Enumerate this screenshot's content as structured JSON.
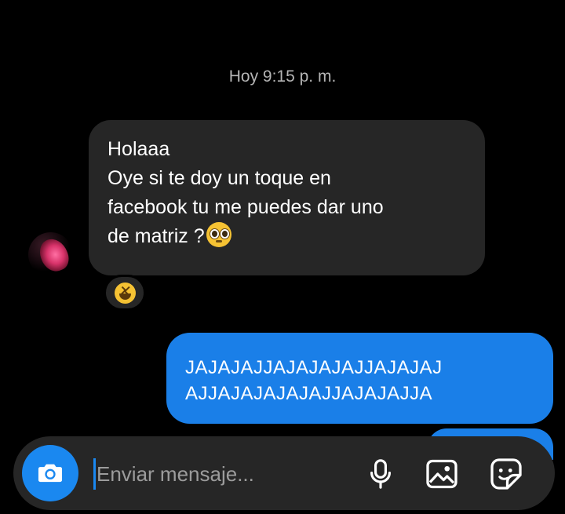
{
  "conversation": {
    "timestamp": "Hoy 9:15 p. m.",
    "incoming": {
      "lines": [
        "Holaaa",
        "Oye si te doy un toque en",
        "facebook tu me puedes dar uno",
        "de matriz ?"
      ],
      "inline_emoji": "pleading-face-emoji",
      "reaction_emoji": "laughing-face-emoji"
    },
    "outgoing": {
      "lines": [
        "JAJAJAJJAJAJAJAJJAJAJAJ",
        "AJJAJAJAJAJAJJAJAJAJJA"
      ]
    }
  },
  "composer": {
    "placeholder": "Enviar mensaje...",
    "value": "",
    "icons": [
      "camera-icon",
      "microphone-icon",
      "image-icon",
      "sticker-icon"
    ]
  },
  "colors": {
    "background": "#000000",
    "incoming_bubble": "#262626",
    "outgoing_bubble": "#1a7fe8",
    "accent": "#1a88f0",
    "timestamp_text": "#b5b5b5"
  }
}
